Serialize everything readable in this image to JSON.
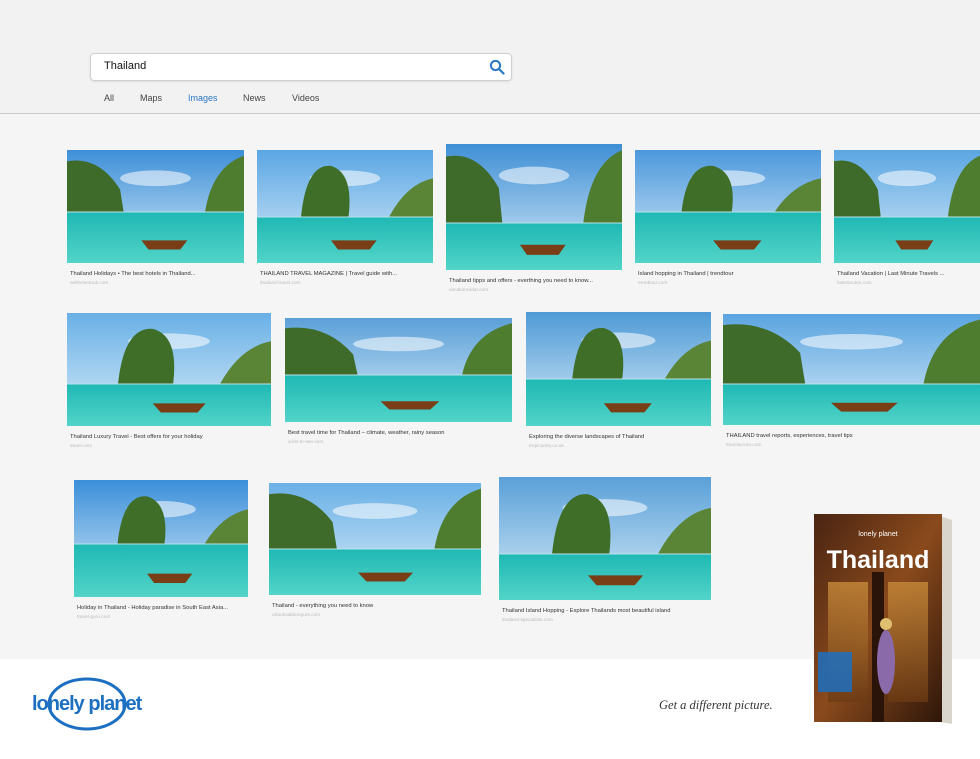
{
  "search": {
    "query": "Thailand"
  },
  "tabs": [
    "All",
    "Maps",
    "Images",
    "News",
    "Videos"
  ],
  "active_tab": "Images",
  "results": [
    {
      "caption": "Thailand Holidays • The best hotels in Thailand...",
      "source": "weltreisetouk.com"
    },
    {
      "caption": "THAILAND TRAVEL MAGAZINE | Travel guide with...",
      "source": "thailand-travel.com"
    },
    {
      "caption": "Thailand tipps and offers - everthing you need to know...",
      "source": "vacationradar.com"
    },
    {
      "caption": "Island hopping in Thailand | trendtour",
      "source": "trendtour.com"
    },
    {
      "caption": "Thailand Vacation | Last Minute Travels ...",
      "source": "lastminutes.com"
    },
    {
      "caption": "Thailand Luxury Travel - Best offers for your holiday",
      "source": "travel.com"
    },
    {
      "caption": "Best travel time for Thailand – climate, weather, rainy season",
      "source": "a-list-to-see.com"
    },
    {
      "caption": "Exploring the diverse landscapes of Thailand",
      "source": "tropicantry.co.uk"
    },
    {
      "caption": "THAILAND travel reports, experiences, travel tips",
      "source": "travelarcom.com"
    },
    {
      "caption": "Holiday in Thailand - Holiday paradise in South East Asia...",
      "source": "travel-guru.com"
    },
    {
      "caption": "Thailand - everything you need to know",
      "source": "urlaubsaktiongurs.com"
    },
    {
      "caption": "Thailand Island Hopping - Explore Thailands most beautiful island",
      "source": "thailand-specialists.com"
    }
  ],
  "brand": {
    "logo_text": "lonely planet",
    "tagline": "Get a different picture."
  },
  "book": {
    "title": "Thailand",
    "publisher": "lonely planet"
  },
  "colors": {
    "accent": "#2b79c2",
    "sea": "#2ec4c0",
    "sky": "#4a9be0",
    "brand_blue": "#1c6fc1"
  }
}
